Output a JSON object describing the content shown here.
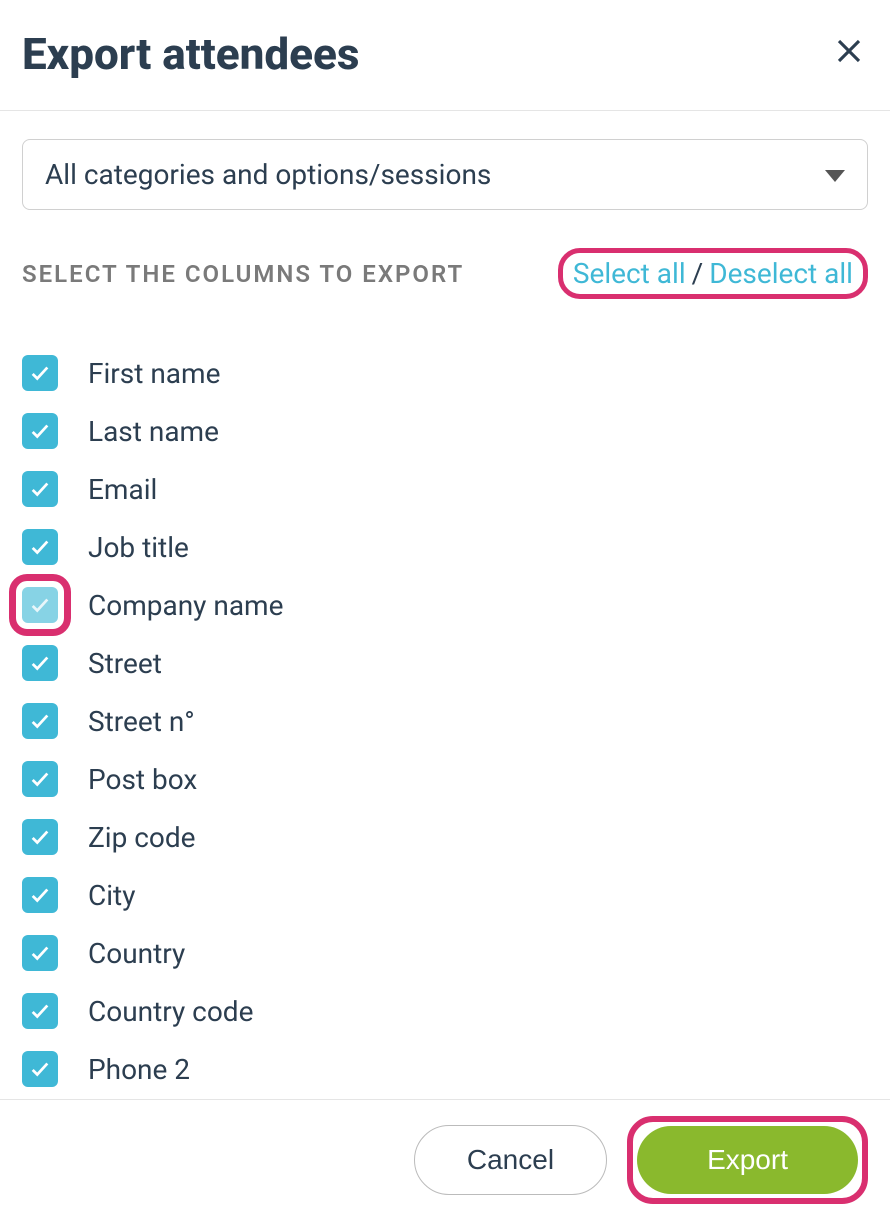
{
  "header": {
    "title": "Export attendees"
  },
  "dropdown": {
    "value": "All categories and options/sessions"
  },
  "section": {
    "label": "SELECT THE COLUMNS TO EXPORT",
    "select_all": "Select all",
    "deselect_all": "Deselect all",
    "separator": "/"
  },
  "columns": [
    {
      "label": "First name",
      "checked": true,
      "highlighted": false
    },
    {
      "label": "Last name",
      "checked": true,
      "highlighted": false
    },
    {
      "label": "Email",
      "checked": true,
      "highlighted": false
    },
    {
      "label": "Job title",
      "checked": true,
      "highlighted": false
    },
    {
      "label": "Company name",
      "checked": true,
      "highlighted": true
    },
    {
      "label": "Street",
      "checked": true,
      "highlighted": false
    },
    {
      "label": "Street n°",
      "checked": true,
      "highlighted": false
    },
    {
      "label": "Post box",
      "checked": true,
      "highlighted": false
    },
    {
      "label": "Zip code",
      "checked": true,
      "highlighted": false
    },
    {
      "label": "City",
      "checked": true,
      "highlighted": false
    },
    {
      "label": "Country",
      "checked": true,
      "highlighted": false
    },
    {
      "label": "Country code",
      "checked": true,
      "highlighted": false
    },
    {
      "label": "Phone 2",
      "checked": true,
      "highlighted": false
    }
  ],
  "footer": {
    "cancel": "Cancel",
    "export": "Export"
  }
}
